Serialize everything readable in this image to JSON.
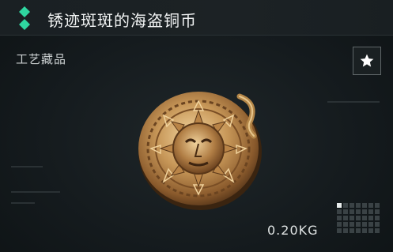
{
  "item": {
    "name": "锈迹斑斑的海盗铜币",
    "category": "工艺藏品",
    "weight": "0.20KG",
    "icon": "pirate-sun-coin",
    "rarity_color": "#2fd6a0"
  },
  "actions": {
    "favorite_icon": "star-icon"
  },
  "size_grid": {
    "cols": 7,
    "rows": 5,
    "occupied": 1
  }
}
